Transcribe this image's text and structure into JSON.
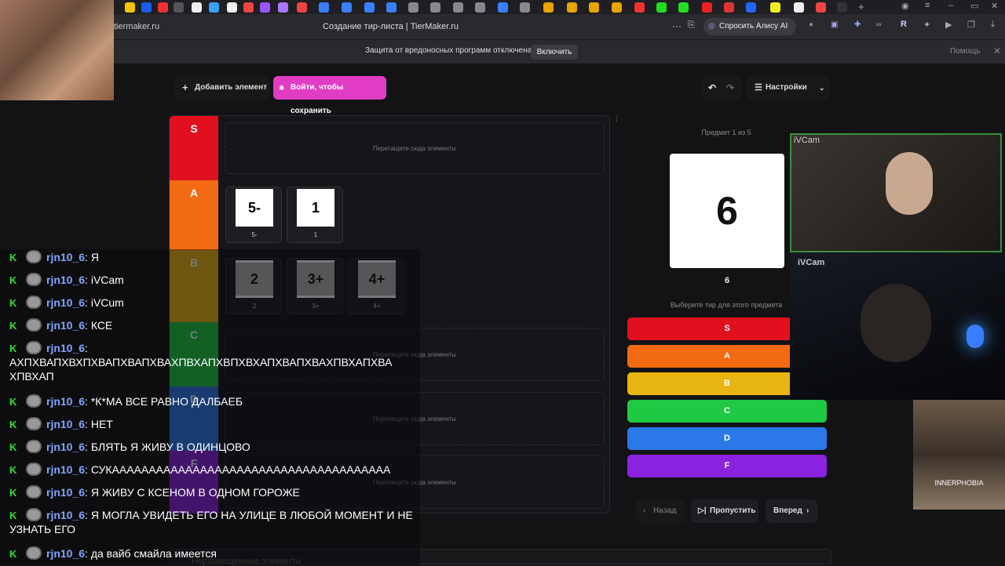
{
  "browser": {
    "url": "tiermaker.ru",
    "title": "Создание тир-листа | TierMaker.ru",
    "alice_label": "Спросить Алису AI",
    "more": "···"
  },
  "infobar": {
    "message": "Защита от вредоносных программ отключена",
    "enable": "Включить",
    "help": "Помощь",
    "close": "✕"
  },
  "toolbar": {
    "add_element": "Добавить элемент",
    "login_save": "Войти, чтобы сохранить",
    "settings": "Настройки"
  },
  "tiers": [
    {
      "label": "S",
      "color": "#e0101e"
    },
    {
      "label": "A",
      "color": "#f26a12"
    },
    {
      "label": "B",
      "color": "#e8b411"
    },
    {
      "label": "C",
      "color": "#20c944"
    },
    {
      "label": "D",
      "color": "#2b78e8"
    },
    {
      "label": "F",
      "color": "#8b22e0"
    }
  ],
  "drop_hint": "Перетащите сюда элементы",
  "cards": [
    {
      "img": "5-",
      "label": "5-",
      "gray": false
    },
    {
      "img": "1",
      "label": "1",
      "gray": false
    },
    {
      "img": "2",
      "label": "2",
      "gray": true
    },
    {
      "img": "3+",
      "label": "3+",
      "gray": true
    },
    {
      "img": "4+",
      "label": "4+",
      "gray": true
    }
  ],
  "side": {
    "counter": "Предмет 1 из 5",
    "current": "6",
    "current_label": "6",
    "prompt": "Выберите тир для этого предмета",
    "back": "Назад",
    "skip": "Пропустить",
    "forward": "Вперед"
  },
  "bottom_label": "Неразмещенные элементы",
  "chat": [
    {
      "user": "rjn10_6",
      "text": "Я"
    },
    {
      "user": "rjn10_6",
      "text": "iVCam"
    },
    {
      "user": "rjn10_6",
      "text": "iVCum"
    },
    {
      "user": "rjn10_6",
      "text": "КСЕ"
    },
    {
      "user": "rjn10_6",
      "text": "АХПХВАПХВХПХВАПХВАПХВАХПВХАПХВПХВХАПХВАПХВАХПВХАПХВА ХПВХАП"
    },
    {
      "user": "rjn10_6",
      "text": "*К*МА ВСЕ РАВНО ДАЛБАЕБ"
    },
    {
      "user": "rjn10_6",
      "text": "НЕТ"
    },
    {
      "user": "rjn10_6",
      "text": "БЛЯТЬ Я ЖИВУ В ОДИНЦОВО"
    },
    {
      "user": "rjn10_6",
      "text": "СУКАААААААААААААААААААААААААААААААААААААА"
    },
    {
      "user": "rjn10_6",
      "text": "Я ЖИВУ С КСЕНОМ В ОДНОМ ГОРОЖЕ"
    },
    {
      "user": "rjn10_6",
      "text": "Я МОГЛА УВИДЕТЬ ЕГО НА УЛИЦЕ В ЛЮБОЙ МОМЕНТ И НЕ УЗНАТЬ ЕГО"
    },
    {
      "user": "rjn10_6",
      "text": "да вайб смайла имеется"
    }
  ],
  "overlays": {
    "cam1": "iVCam",
    "cam2": "iVCam",
    "dog": "INNERPHOBIA"
  }
}
